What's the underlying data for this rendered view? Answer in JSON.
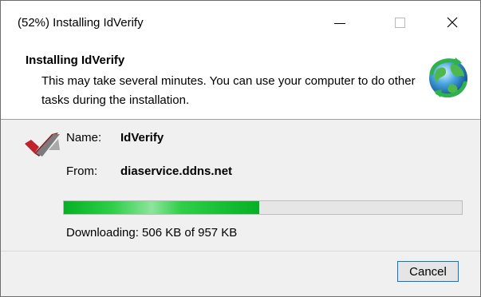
{
  "window": {
    "title": "(52%) Installing IdVerify"
  },
  "header": {
    "title": "Installing IdVerify",
    "description": "This may take several minutes. You can use your computer to do other tasks during the installation.",
    "icon": "globe-refresh-icon"
  },
  "details": {
    "name_label": "Name:",
    "name_value": "IdVerify",
    "from_label": "From:",
    "from_value": "diaservice.ddns.net",
    "app_icon": "checkmark-icon"
  },
  "progress": {
    "fraction": 0.49,
    "status_text": "Downloading: 506 KB of 957 KB",
    "color": "#06b025"
  },
  "footer": {
    "cancel_label": "Cancel"
  },
  "colors": {
    "accent": "#0078d7"
  }
}
